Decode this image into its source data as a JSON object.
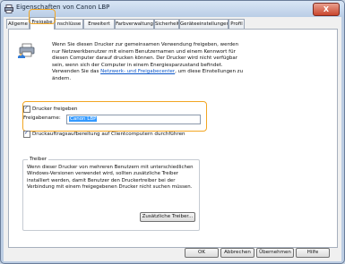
{
  "window": {
    "title": "Eigenschaften von Canon LBP",
    "close_label": "X"
  },
  "tabs": [
    {
      "label": "Allgeme"
    },
    {
      "label": "Freigabe"
    },
    {
      "label": "nschlüsse"
    },
    {
      "label": "Erweitert"
    },
    {
      "label": "Farbverwaltung"
    },
    {
      "label": "Sicherheit"
    },
    {
      "label": "Geräteeinstellungen"
    },
    {
      "label": "Profil"
    }
  ],
  "intro": {
    "text": "Wenn Sie diesen Drucker zur gemeinsamen Verwendung freigeben, werden nur Netzwerkbenutzer mit einem Benutzernamen und einem Kennwort für diesen Computer darauf drucken können. Der Drucker wird nicht verfügbar sein, wenn sich der Computer in einem Energiesparzustand befindet. Verwenden Sie das",
    "link": "Netzwerk- und Freigabecenter",
    "suffix": ", um diese Einstellungen zu ändern."
  },
  "share": {
    "checkbox_label": "Drucker freigeben",
    "checked": true,
    "name_label": "Freigabename:",
    "name_value": "Canon LBP"
  },
  "client_render": {
    "label": "Druckauftragsaufbereitung auf Clientcomputern durchführen",
    "checked": true
  },
  "drivers": {
    "legend": "Treiber",
    "text": "Wenn dieser Drucker von mehreren Benutzern mit unterschiedlichen Windows-Versionen verwendet wird, sollten zusätzliche Treiber installiert werden, damit Benutzer den Druckertreiber bei der Verbindung mit einem freigegebenen Drucker nicht suchen müssen.",
    "button": "Zusätzliche Treiber..."
  },
  "buttons": {
    "ok": "OK",
    "cancel": "Abbrechen",
    "apply": "Übernehmen",
    "help": "Hilfe"
  }
}
